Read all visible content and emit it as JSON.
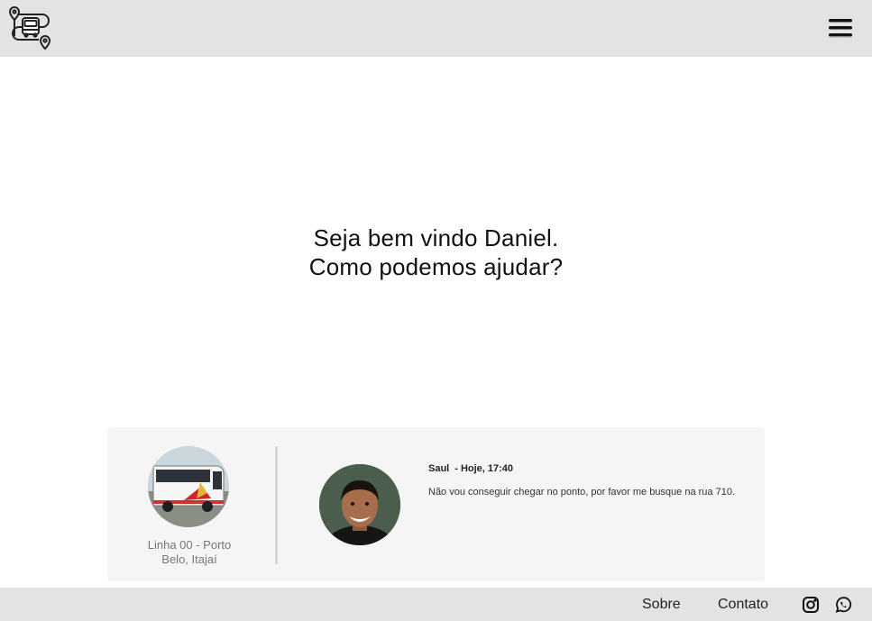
{
  "header": {
    "logo_icon": "bus-route-location-logo-icon",
    "menu_icon": "hamburger-menu-icon"
  },
  "welcome": {
    "line1": "Seja bem vindo Daniel.",
    "line2": "Como podemos ajudar?"
  },
  "notification": {
    "bus_icon": "bus-photo",
    "line_label": "Linha 00 - Porto Belo, Itajaí",
    "sender_avatar": "user-avatar-photo",
    "sender_name": "Saul",
    "time": "- Hoje, 17:40",
    "message": "Não vou conseguir chegar no ponto, por favor me busque na rua 710."
  },
  "footer": {
    "sobre_label": "Sobre",
    "contato_label": "Contato",
    "instagram_icon": "instagram-icon",
    "whatsapp_icon": "whatsapp-icon"
  },
  "colors": {
    "bar_background": "#e3e3e3",
    "card_background": "#f5f5f5",
    "text_primary": "#111111",
    "caption_gray": "#777777"
  }
}
